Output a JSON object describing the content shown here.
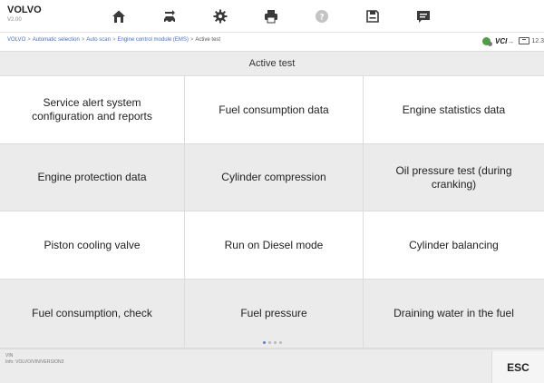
{
  "header": {
    "brand": "VOLVO",
    "version": "V2.00",
    "toolbar": [
      {
        "icon": "home-icon",
        "name": "home-button"
      },
      {
        "icon": "vehicle-swap-icon",
        "name": "vehicle-swap-button"
      },
      {
        "icon": "gear-icon",
        "name": "settings-button"
      },
      {
        "icon": "printer-icon",
        "name": "print-button"
      },
      {
        "icon": "help-icon",
        "name": "help-button"
      },
      {
        "icon": "save-icon",
        "name": "save-button"
      },
      {
        "icon": "message-icon",
        "name": "data-log-button"
      }
    ]
  },
  "breadcrumb": {
    "items": [
      "VOLVO",
      "Automatic selection",
      "Auto scan",
      "Engine control module (EMS)"
    ],
    "separator": ">",
    "current": "Active test"
  },
  "status": {
    "vci_label": "VCI",
    "battery": "12.3"
  },
  "page_title": "Active test",
  "tests": [
    [
      "Service alert system configuration and reports",
      "Fuel consumption data",
      "Engine statistics data"
    ],
    [
      "Engine protection data",
      "Cylinder compression",
      "Oil pressure test (during cranking)"
    ],
    [
      "Piston cooling valve",
      "Run on Diesel mode",
      "Cylinder balancing"
    ],
    [
      "Fuel consumption, check",
      "Fuel pressure",
      "Draining water in the fuel"
    ]
  ],
  "pager": {
    "pages": 4,
    "current": 1
  },
  "footer": {
    "vin_label": "VIN",
    "info": "Info: VOLVO/VIN/VERSION3",
    "esc_label": "ESC"
  },
  "colors": {
    "accent_link": "#4a70b8",
    "status_green": "#4e9e43",
    "stripe": "#ebebeb"
  }
}
